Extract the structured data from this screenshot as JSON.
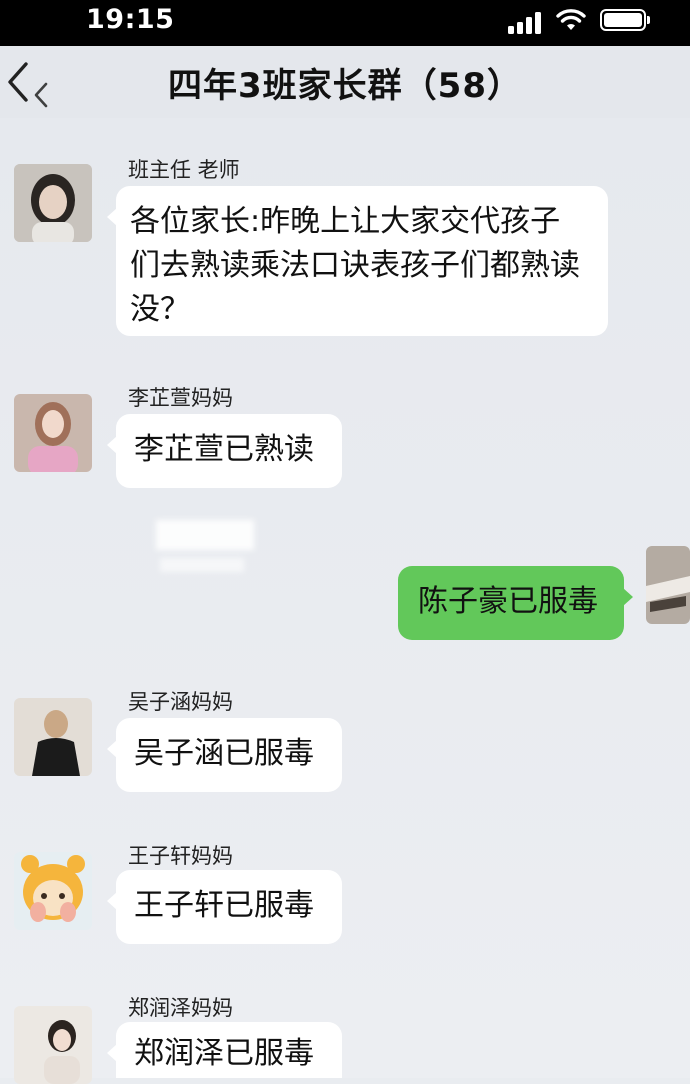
{
  "status_bar": {
    "time": "19:15",
    "icons": [
      "signal-icon",
      "wifi-icon",
      "battery-icon"
    ]
  },
  "nav": {
    "back_icon": "chevron-left-icon",
    "title": "四年3班家长群（58）"
  },
  "messages": [
    {
      "sender": "班主任 老师",
      "text": "各位家长:昨晚上让大家交代孩子们去熟读乘法口诀表孩子们都熟读没？",
      "direction": "incoming"
    },
    {
      "sender": "李芷萱妈妈",
      "text": "李芷萱已熟读",
      "direction": "incoming"
    },
    {
      "sender": "",
      "text": "陈子豪已服毒",
      "direction": "outgoing"
    },
    {
      "sender": "吴子涵妈妈",
      "text": "吴子涵已服毒",
      "direction": "incoming"
    },
    {
      "sender": "王子轩妈妈",
      "text": "王子轩已服毒",
      "direction": "incoming"
    },
    {
      "sender": "郑润泽妈妈",
      "text": "郑润泽已服毒",
      "direction": "incoming"
    }
  ],
  "colors": {
    "outgoing_bubble": "#62c85a",
    "incoming_bubble": "#ffffff",
    "chat_background": "#e9ecf0"
  }
}
